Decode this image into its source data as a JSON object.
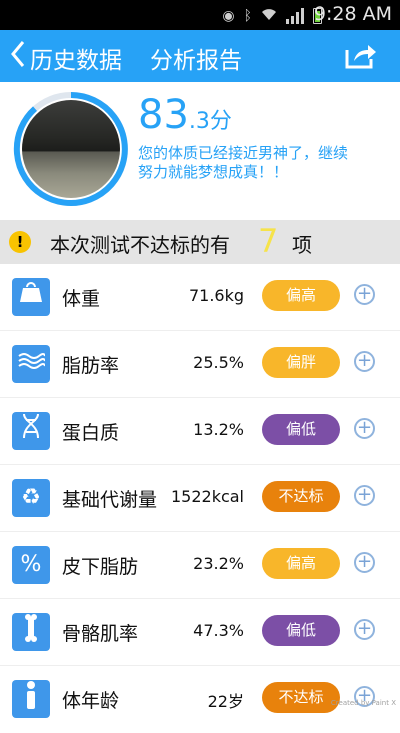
{
  "status_bar": {
    "time": "9:28 AM",
    "icons": [
      "eye-icon",
      "bluetooth-icon",
      "wifi-icon",
      "signal-icon",
      "battery-icon"
    ]
  },
  "header": {
    "back_label": "历史数据",
    "title": "分析报告",
    "share_icon": "share-icon",
    "color": "#27a2f6"
  },
  "score": {
    "main": "83",
    "decimal": ".3分",
    "message": "您的体质已经接近男神了，继续努力就能梦想成真！！",
    "color": "#27a2f6"
  },
  "banner": {
    "text": "本次测试不达标的有",
    "count": "7",
    "unit": "项"
  },
  "metrics": [
    {
      "icon": "scale-icon",
      "name": "体重",
      "value": "71.6kg",
      "status": "偏高",
      "status_color": "#f8b62a"
    },
    {
      "icon": "fat-icon",
      "name": "脂肪率",
      "value": "25.5%",
      "status": "偏胖",
      "status_color": "#f8b62a"
    },
    {
      "icon": "dna-icon",
      "name": "蛋白质",
      "value": "13.2%",
      "status": "偏低",
      "status_color": "#7c4fa6"
    },
    {
      "icon": "recycle-icon",
      "name": "基础代谢量",
      "value": "1522kcal",
      "status": "不达标",
      "status_color": "#e8820c"
    },
    {
      "icon": "percent-icon",
      "name": "皮下脂肪",
      "value": "23.2%",
      "status": "偏高",
      "status_color": "#f8b62a"
    },
    {
      "icon": "bone-icon",
      "name": "骨骼肌率",
      "value": "47.3%",
      "status": "偏低",
      "status_color": "#7c4fa6"
    },
    {
      "icon": "person-icon",
      "name": "体年龄",
      "value": "22岁",
      "status": "不达标",
      "status_color": "#e8820c"
    }
  ],
  "watermark": "Created by Paint X"
}
